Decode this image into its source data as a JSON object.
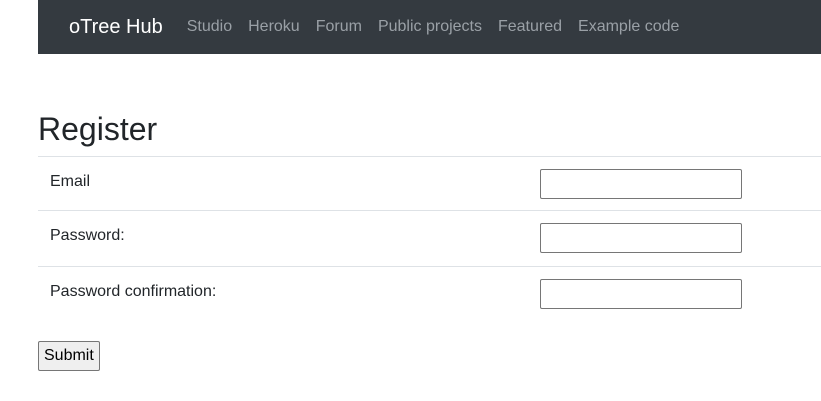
{
  "navbar": {
    "brand": "oTree Hub",
    "links": [
      "Studio",
      "Heroku",
      "Forum",
      "Public projects",
      "Featured",
      "Example code"
    ]
  },
  "page": {
    "title": "Register"
  },
  "form": {
    "fields": [
      {
        "label": "Email",
        "value": ""
      },
      {
        "label": "Password:",
        "value": ""
      },
      {
        "label": "Password confirmation:",
        "value": ""
      }
    ],
    "submit_label": "Submit"
  },
  "colors": {
    "navbar_bg": "#343a40",
    "brand": "#ffffff",
    "nav_link": "#9aa0a6"
  }
}
